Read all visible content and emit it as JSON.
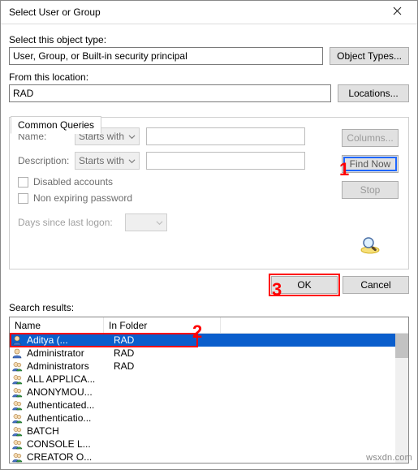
{
  "window": {
    "title": "Select User or Group"
  },
  "labels": {
    "object_type": "Select this object type:",
    "location": "From this location:",
    "search_results": "Search results:"
  },
  "inputs": {
    "object_type_value": "User, Group, or Built-in security principal",
    "location_value": "RAD"
  },
  "buttons": {
    "object_types": "Object Types...",
    "locations": "Locations...",
    "columns": "Columns...",
    "find_now": "Find Now",
    "stop": "Stop",
    "ok": "OK",
    "cancel": "Cancel"
  },
  "tabs": {
    "common_queries": "Common Queries"
  },
  "cq": {
    "name": "Name:",
    "desc": "Description:",
    "starts_with": "Starts with",
    "disabled": "Disabled accounts",
    "nonexp": "Non expiring password",
    "days": "Days since last logon:"
  },
  "headers": {
    "name": "Name",
    "folder": "In Folder"
  },
  "results": [
    {
      "icon": "user",
      "name": "Aditya       (...",
      "folder": "RAD",
      "selected": true
    },
    {
      "icon": "user",
      "name": "Administrator",
      "folder": "RAD"
    },
    {
      "icon": "users",
      "name": "Administrators",
      "folder": "RAD"
    },
    {
      "icon": "users",
      "name": "ALL APPLICA..."
    },
    {
      "icon": "users",
      "name": "ANONYMOU..."
    },
    {
      "icon": "users",
      "name": "Authenticated..."
    },
    {
      "icon": "users",
      "name": "Authenticatio..."
    },
    {
      "icon": "users",
      "name": "BATCH"
    },
    {
      "icon": "users",
      "name": "CONSOLE L..."
    },
    {
      "icon": "users",
      "name": "CREATOR O..."
    }
  ],
  "annotations": {
    "a1": "1",
    "a2": "2",
    "a3": "3"
  },
  "watermark": "wsxdn.com"
}
